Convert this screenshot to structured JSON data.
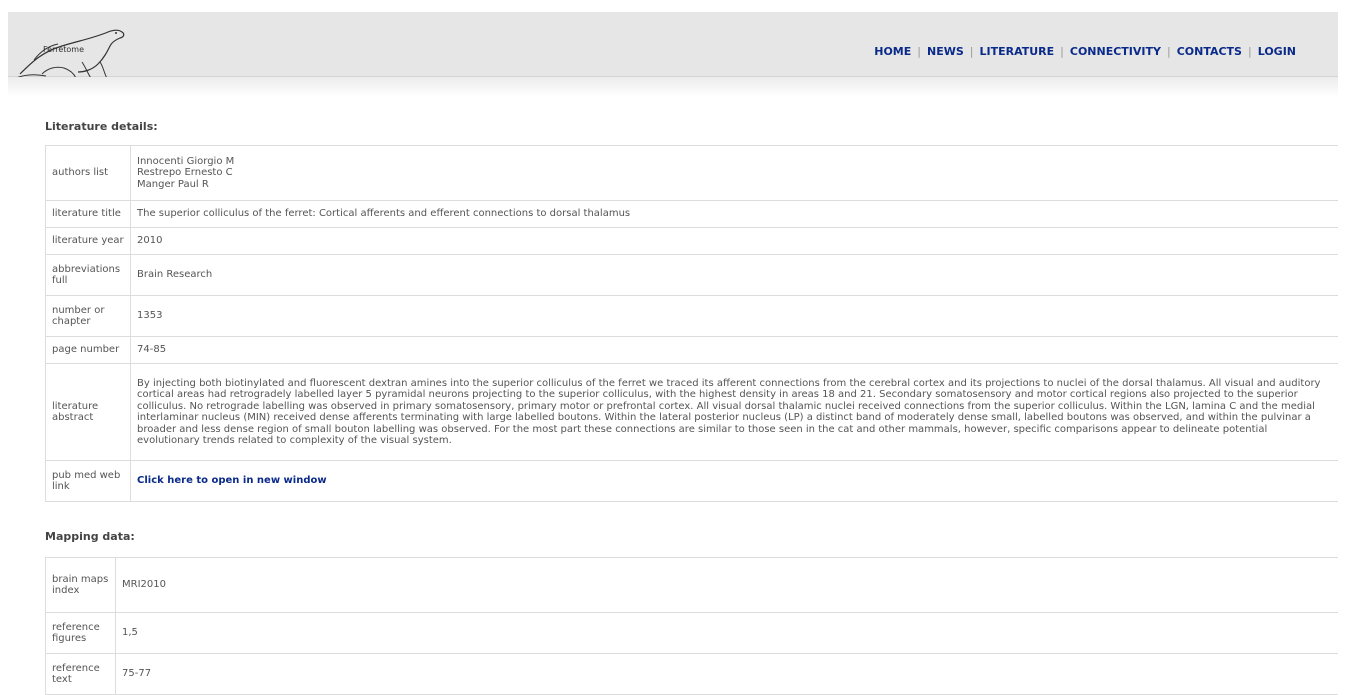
{
  "logo": {
    "text": "Ferretome"
  },
  "nav": {
    "items": [
      "HOME",
      "NEWS",
      "LITERATURE",
      "CONNECTIVITY",
      "CONTACTS",
      "LOGIN"
    ],
    "separator": "|"
  },
  "literature": {
    "heading": "Literature details:",
    "authors_label": "authors list",
    "authors": [
      "Innocenti Giorgio M",
      "Restrepo Ernesto C",
      "Manger Paul R"
    ],
    "title_label": "literature title",
    "title": "The superior colliculus of the ferret: Cortical afferents and efferent connections to dorsal thalamus",
    "year_label": "literature year",
    "year": "2010",
    "abbrev_label": "abbreviations full",
    "abbrev": "Brain Research",
    "number_label": "number or chapter",
    "number": "1353",
    "pages_label": "page number",
    "pages": "74-85",
    "abstract_label": "literature abstract",
    "abstract": "By injecting both biotinylated and fluorescent dextran amines into the superior colliculus of the ferret we traced its afferent connections from the cerebral cortex and its projections to nuclei of the dorsal thalamus. All visual and auditory cortical areas had retrogradely labelled layer 5 pyramidal neurons projecting to the superior colliculus, with the highest density in areas 18 and 21. Secondary somatosensory and motor cortical regions also projected to the superior colliculus. No retrograde labelling was observed in primary somatosensory, primary motor or prefrontal cortex. All visual dorsal thalamic nuclei received connections from the superior colliculus. Within the LGN, lamina C and the medial interlaminar nucleus (MIN) received dense afferents terminating with large labelled boutons. Within the lateral posterior nucleus (LP) a distinct band of moderately dense small, labelled boutons was observed, and within the pulvinar a broader and less dense region of small bouton labelling was observed. For the most part these connections are similar to those seen in the cat and other mammals, however, specific comparisons appear to delineate potential evolutionary trends related to complexity of the visual system.",
    "pubmed_label": "pub med web link",
    "pubmed_link": "Click here to open in new window"
  },
  "mapping": {
    "heading": "Mapping data:",
    "index_label": "brain maps index",
    "index": "MRI2010",
    "figures_label": "reference figures",
    "figures": "1,5",
    "text_label": "reference text",
    "text": "75-77"
  }
}
